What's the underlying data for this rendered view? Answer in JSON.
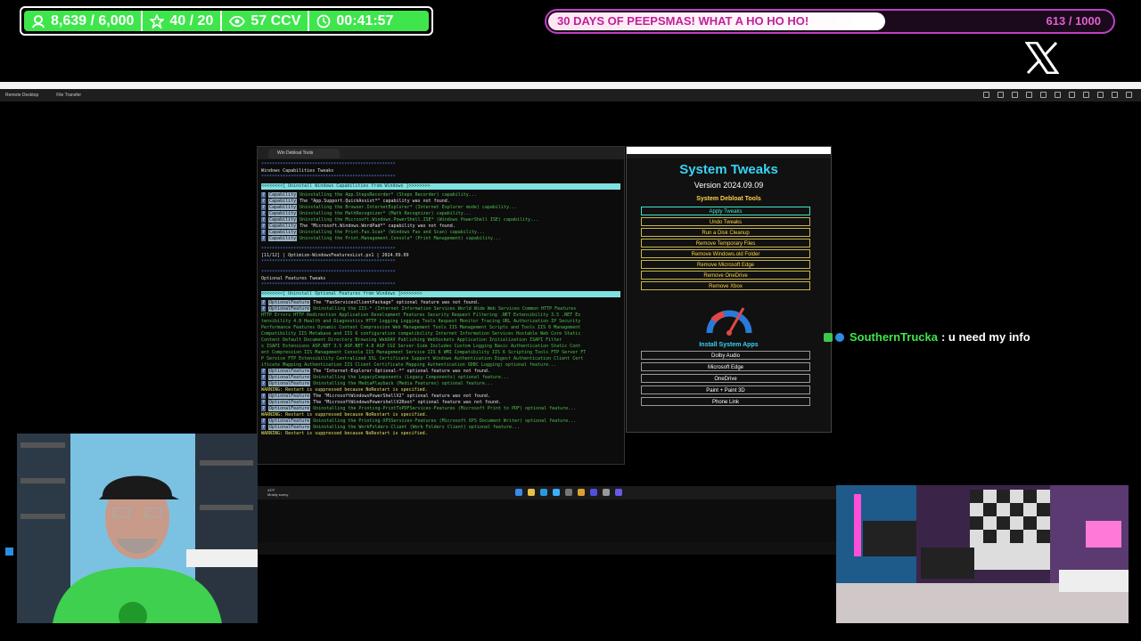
{
  "overlay": {
    "stats": [
      {
        "icon": "person-icon",
        "value": "8,639 / 6,000"
      },
      {
        "icon": "star-icon",
        "value": "40 / 20"
      },
      {
        "icon": "eye-icon",
        "value": "57 CCV"
      },
      {
        "icon": "clock-icon",
        "value": "00:41:57"
      }
    ],
    "goal": {
      "title": "30 DAYS OF PEEPSMAS! WHAT A HO HO HO!",
      "count": "613 / 1000",
      "progress": 0.613
    }
  },
  "remote_desktop": {
    "tabs": [
      "Remote Desktop",
      "File Transfer"
    ]
  },
  "terminal": {
    "tab_title": "Win Debloat Tools",
    "section1_title": "Windows Capabilities Tweaks",
    "section1_bar": "<<<<<<<<[ Uninstall Windows Capabilities from Windows ]>>>>>>>>",
    "cap_label": "Capability",
    "cap_lines": [
      {
        "text": "Uninstalling the App.StepsRecorder* (Steps Recorder) capability...",
        "type": "green"
      },
      {
        "text": "The \"App.Support.QuickAssist*\" capability was not found.",
        "type": "white"
      },
      {
        "text": "Uninstalling the Browser.InternetExplorer* (Internet Explorer mode) capability...",
        "type": "green"
      },
      {
        "text": "Uninstalling the MathRecognizer* (Math Recognizer) capability...",
        "type": "green"
      },
      {
        "text": "Uninstalling the Microsoft.Windows.PowerShell.ISE* (Windows PowerShell ISE) capability...",
        "type": "green"
      },
      {
        "text": "The \"Microsoft.Windows.WordPad*\" capability was not found.",
        "type": "white"
      },
      {
        "text": "Uninstalling the Print.Fax.Scan* (Windows Fax and Scan) capability...",
        "type": "green"
      },
      {
        "text": "Uninstalling the Print.Management.Console* (Print Management) capability...",
        "type": "green"
      }
    ],
    "script_line": "[11/12] | Optimize-WindowsFeaturesList.ps1 | 2024.09.09",
    "section2_title": "Optional Features Tweaks",
    "section2_bar": "<<<<<<<<[ Uninstall Optional Features from Windows ]>>>>>>>>",
    "feat_label": "OptionalFeature",
    "feat_lines": [
      {
        "text": "The \"FaxServicesClientPackage\" optional feature was not found.",
        "type": "white",
        "label": true
      },
      {
        "text": "Uninstalling the IIS-* (Internet Information Services World Wide Web Services Common HTTP Features",
        "type": "green",
        "label": true
      },
      {
        "text": "HTTP Errors HTTP Redirection Application Development Features Security Request Filtering .NET Extensibility 3.5 .NET Ex",
        "type": "green",
        "label": false
      },
      {
        "text": "tensibility 4.8 Health and Diagnostics HTTP Logging Logging Tools Request Monitor Tracing URL Authorization IP Security",
        "type": "green",
        "label": false
      },
      {
        "text": "Performance Features Dynamic Content Compression Web Management Tools IIS Management Scripts and Tools IIS 6 Management",
        "type": "green",
        "label": false
      },
      {
        "text": "Compatibility IIS Metabase and IIS 6 configuration compatibility Internet Information Services Hostable Web Core Static",
        "type": "green",
        "label": false
      },
      {
        "text": "Content Default Document Directory Browsing WebDAV Publishing WebSockets Application Initialization ISAPI Filter",
        "type": "green",
        "label": false
      },
      {
        "text": "s ISAPI Extensions ASP.NET 3.5 ASP.NET 4.8 ASP CGI Server-Side Includes Custom Logging Basic Authentication Static Cont",
        "type": "green",
        "label": false
      },
      {
        "text": "ent Compression IIS Management Console IIS Management Service IIS 6 WMI Compatibility IIS 6 Scripting Tools FTP Server FT",
        "type": "green",
        "label": false
      },
      {
        "text": "P Service FTP Extensibility Centralized SSL Certificate Support Windows Authentication Digest Authentication Client Cert",
        "type": "green",
        "label": false
      },
      {
        "text": "ificate Mapping Authentication IIS Client Certificate Mapping Authentication ODBC Logging) optional feature...",
        "type": "green",
        "label": false
      },
      {
        "text": "The \"Internet-Explorer-Optional-*\" optional feature was not found.",
        "type": "white",
        "label": true
      },
      {
        "text": "Uninstalling the LegacyComponents (Legacy Components) optional feature...",
        "type": "green",
        "label": true
      },
      {
        "text": "Uninstalling the MediaPlayback (Media Features) optional feature...",
        "type": "green",
        "label": true
      },
      {
        "text": "WARNING: Restart is suppressed because NoRestart is specified.",
        "type": "yellow",
        "label": false
      },
      {
        "text": "The \"MicrosoftWindowsPowerShellV2\" optional feature was not found.",
        "type": "white",
        "label": true
      },
      {
        "text": "The \"MicrosoftWindowsPowershellV2Root\" optional feature was not found.",
        "type": "white",
        "label": true
      },
      {
        "text": "Uninstalling the Printing-PrintToPDFServices-Features (Microsoft Print to PDF) optional feature...",
        "type": "green",
        "label": true
      },
      {
        "text": "WARNING: Restart is suppressed because NoRestart is specified.",
        "type": "yellow",
        "label": false
      },
      {
        "text": "Uninstalling the Printing-XPSServices-Features (Microsoft XPS Document Writer) optional feature...",
        "type": "green",
        "label": true
      },
      {
        "text": "Uninstalling the WorkFolders-Client (Work Folders Client) optional feature...",
        "type": "green",
        "label": true
      },
      {
        "text": "WARNING: Restart is suppressed because NoRestart is specified.",
        "type": "yellow",
        "label": false
      }
    ]
  },
  "tweaks": {
    "title": "System Tweaks",
    "version": "Version 2024.09.09",
    "debloat_heading": "System Debloat Tools",
    "buttons": [
      "Apply Tweaks",
      "Undo Tweaks",
      "Run a Disk Cleanup",
      "Remove Temporary Files",
      "Remove Windows.old Folder",
      "Remove Microsoft Edge",
      "Remove OneDrive",
      "Remove Xbox"
    ],
    "apps_heading": "Install System Apps",
    "apps": [
      "Dolby Audio",
      "Microsoft Edge",
      "OneDrive",
      "Paint + Paint 3D",
      "Phone Link"
    ]
  },
  "chat": {
    "user": "SouthernTrucka",
    "message": ": u need my info"
  },
  "taskbar": {
    "weather_line1": "43°F",
    "weather_line2": "Mostly sunny"
  }
}
